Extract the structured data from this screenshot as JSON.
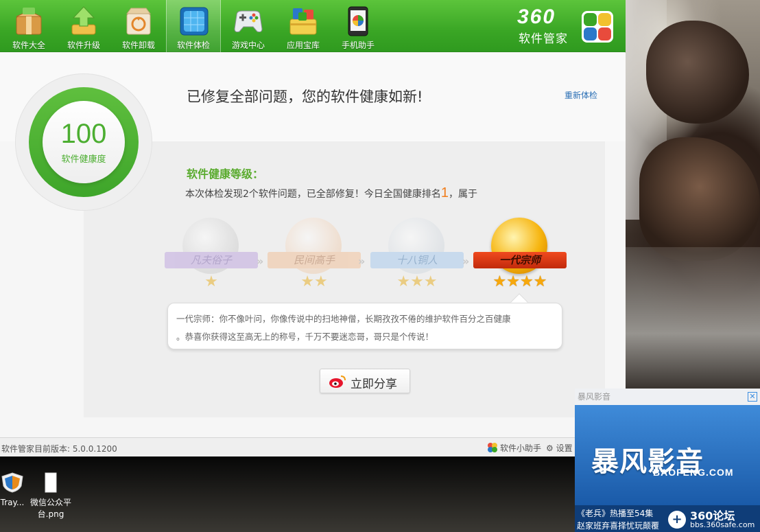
{
  "toolbar": {
    "items": [
      {
        "label": "软件大全",
        "icon": "box-icon"
      },
      {
        "label": "软件升级",
        "icon": "upgrade-arrow-icon"
      },
      {
        "label": "软件卸载",
        "icon": "recycle-box-icon"
      },
      {
        "label": "软件体检",
        "icon": "monitor-check-icon",
        "active": true
      },
      {
        "label": "游戏中心",
        "icon": "gamepad-icon"
      },
      {
        "label": "应用宝库",
        "icon": "app-store-icon"
      },
      {
        "label": "手机助手",
        "icon": "phone-icon"
      }
    ],
    "brand_number": "360",
    "brand_name": "软件管家"
  },
  "score": {
    "value": "100",
    "label": "软件健康度"
  },
  "headline": "已修复全部问题，您的软件健康如新!",
  "recheck_link": "重新体检",
  "grade": {
    "title": "软件健康等级：",
    "desc_prefix": "本次体检发现2个软件问题，已全部修复！今日全国健康排名",
    "rank": "1",
    "desc_suffix": "，属于",
    "levels": [
      {
        "name": "凡夫俗子",
        "stars": 1,
        "achieved": false
      },
      {
        "name": "民间高手",
        "stars": 2,
        "achieved": false
      },
      {
        "name": "十八铜人",
        "stars": 3,
        "achieved": false
      },
      {
        "name": "一代宗师",
        "stars": 4,
        "achieved": true
      }
    ]
  },
  "bubble": {
    "line1": "一代宗师：你不像叶问，你像传说中的扫地神僧，长期孜孜不倦的维护软件百分之百健康",
    "line2": "。恭喜你获得这至高无上的称号，千万不要迷恋哥，哥只是个传说！"
  },
  "share_button": "立即分享",
  "statusbar": {
    "version": "软件管家目前版本: 5.0.0.1200",
    "helper": "软件小助手",
    "settings": "设置"
  },
  "desktop": {
    "icons": [
      {
        "label": "Tray...",
        "icon": "shield-icon"
      },
      {
        "label_line1": "微信公众平",
        "label_line2": "台.png",
        "icon": "file-icon"
      }
    ]
  },
  "ad": {
    "header_logo": "暴风影音",
    "big_title": "暴风影音",
    "sub_title": "BAOFENG.COM",
    "line1": "《老兵》热播至54集",
    "line2": "赵家班弃喜择忧玩颠覆",
    "forum_title": "360论坛",
    "forum_url": "bbs.360safe.com"
  },
  "colors": {
    "brand_green": "#3aa625",
    "score_green": "#4cae31",
    "rank_orange": "#f07d1c",
    "link_blue": "#2a6fb5"
  }
}
